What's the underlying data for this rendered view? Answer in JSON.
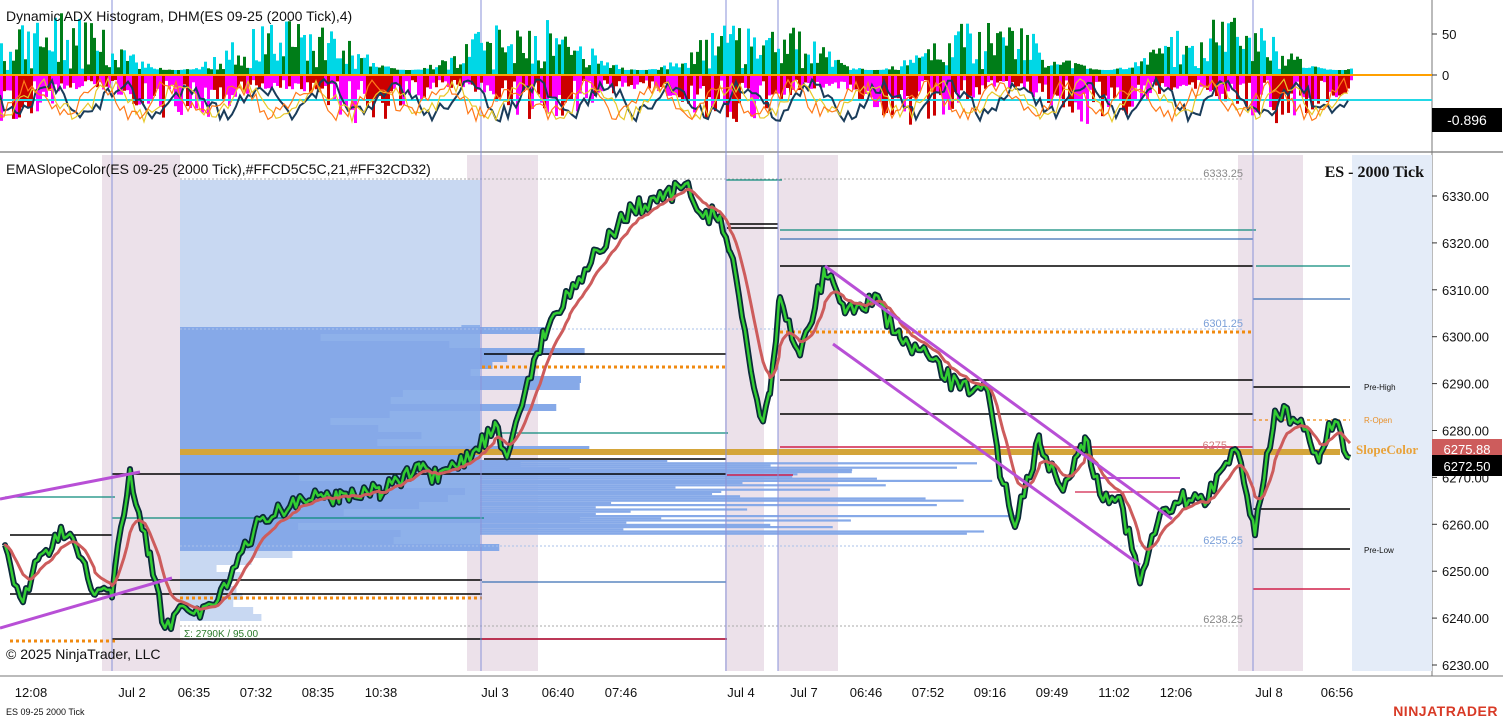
{
  "upper_panel": {
    "title": "Dynamic ADX Histogram, DHM(ES 09-25 (2000 Tick),4)",
    "axis_ticks": [
      "50",
      "0"
    ],
    "value_badge": "-0.896"
  },
  "main_panel": {
    "title": "EMASlopeColor(ES 09-25 (2000 Tick),#FFCD5C5C,21,#FF32CD32)",
    "instrument_label": "ES - 2000 Tick",
    "price_ticks": [
      "6330.00",
      "6320.00",
      "6310.00",
      "6300.00",
      "6290.00",
      "6280.00",
      "6270.00",
      "6260.00",
      "6250.00",
      "6240.00",
      "6230.00"
    ],
    "price_badges": [
      "6275.88",
      "6272.50"
    ],
    "level_labels": [
      "6333.25",
      "6301.25",
      "6275",
      "6255.25",
      "6238.25"
    ],
    "line_labels": [
      "Pre-High",
      "R-Open",
      "Pre-Low"
    ],
    "indicator_tag": "SlopeColor",
    "profile_note": "Σ: 2790K / 95.00",
    "copyright": "© 2025 NinjaTrader, LLC"
  },
  "time_axis": [
    "12:08",
    "Jul 2",
    "06:35",
    "07:32",
    "08:35",
    "10:38",
    "Jul 3",
    "06:40",
    "07:46",
    "Jul 4",
    "Jul 7",
    "06:46",
    "07:52",
    "09:16",
    "09:49",
    "11:02",
    "12:06",
    "Jul 8",
    "06:56"
  ],
  "footer": {
    "instrument": "ES 09-25 2000 Tick",
    "brand": "NINJATRADER"
  },
  "colors": {
    "histogram_up_strong": "#00d7e6",
    "histogram_up": "#007d18",
    "histogram_down_strong": "#ff00ff",
    "histogram_down": "#cc0000",
    "zero_line": "#ffa000",
    "slope_up": "#32CD32",
    "slope_down": "#CD5C5C",
    "trendline": "#b84fd6",
    "session_shade": "#e9dde6",
    "profile": "#7da7e8",
    "poc": "#d4a53a",
    "brand": "#d83a26"
  }
}
